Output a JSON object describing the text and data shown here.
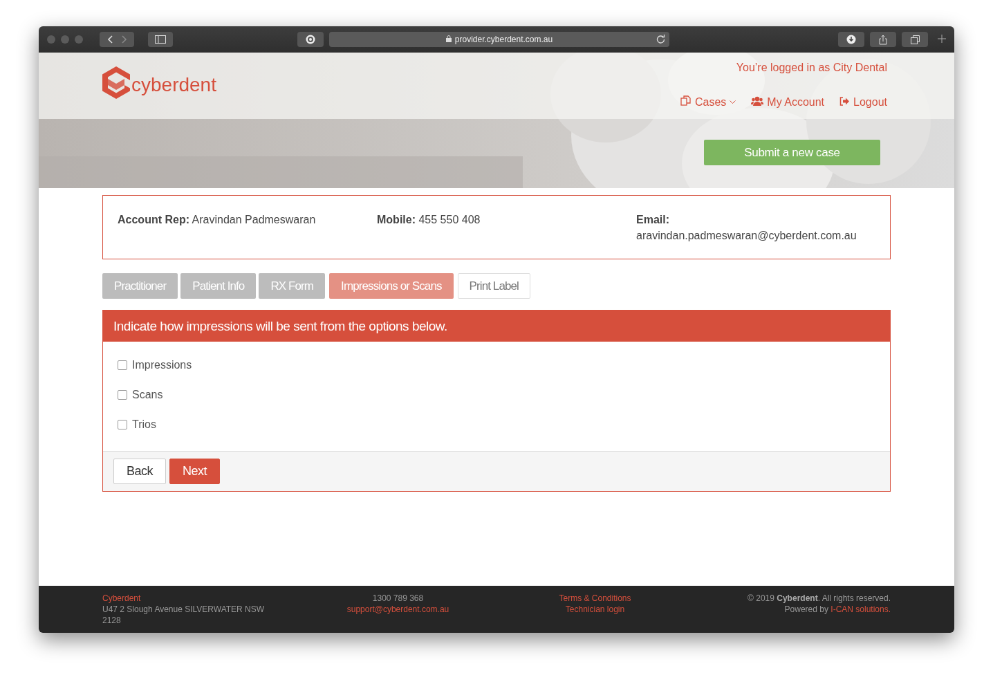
{
  "browser": {
    "url": "provider.cyberdent.com.au"
  },
  "header": {
    "logo_text": "cyberdent",
    "login_status": "You’re logged in as City Dental",
    "nav": [
      {
        "label": "Cases",
        "kind": "dropdown"
      },
      {
        "label": "My Account",
        "kind": "link"
      },
      {
        "label": "Logout",
        "kind": "link"
      }
    ],
    "submit_button": "Submit a new case"
  },
  "account": [
    {
      "label": "Account Rep:",
      "value": "Aravindan Padmeswaran"
    },
    {
      "label": "Mobile:",
      "value": "455 550 408"
    },
    {
      "label": "Email:",
      "value": "aravindan.padmeswaran@cyberdent.com.au"
    }
  ],
  "steps": [
    {
      "label": "Practitioner",
      "selected": false
    },
    {
      "label": "Patient Info",
      "selected": false
    },
    {
      "label": "RX Form",
      "selected": false
    },
    {
      "label": "Impressions or Scans",
      "selected": true
    },
    {
      "label": "Print Label",
      "selected": false
    }
  ],
  "panel": {
    "heading": "Indicate how impressions will be sent from the options below.",
    "options": [
      {
        "label": "Impressions",
        "checked": false
      },
      {
        "label": "Scans",
        "checked": false
      },
      {
        "label": "Trios",
        "checked": false
      }
    ],
    "buttons": [
      {
        "label": "Back",
        "kind": "secondary"
      },
      {
        "label": "Next",
        "kind": "primary"
      }
    ]
  },
  "footer": {
    "columns": [
      {
        "lines": [
          [
            {
              "text": "Cyberdent",
              "kind": "link"
            }
          ],
          [
            {
              "text": "U47 2 Slough Avenue SILVERWATER NSW 2128",
              "kind": "text"
            }
          ]
        ]
      },
      {
        "lines": [
          [
            {
              "text": "1300 789 368",
              "kind": "text"
            }
          ],
          [
            {
              "text": "support@cyberdent.com.au",
              "kind": "link"
            }
          ]
        ]
      },
      {
        "lines": [
          [
            {
              "text": "Terms & Conditions",
              "kind": "link"
            }
          ],
          [
            {
              "text": "Technician login",
              "kind": "link"
            }
          ]
        ]
      },
      {
        "lines": [
          [
            {
              "text": "© 2019 **Cyberdent**. All rights reserved.",
              "kind": "text"
            }
          ],
          [
            {
              "text": "Powered by ",
              "kind": "text"
            },
            {
              "text": "I-CAN solutions.",
              "kind": "link"
            }
          ]
        ]
      }
    ]
  }
}
